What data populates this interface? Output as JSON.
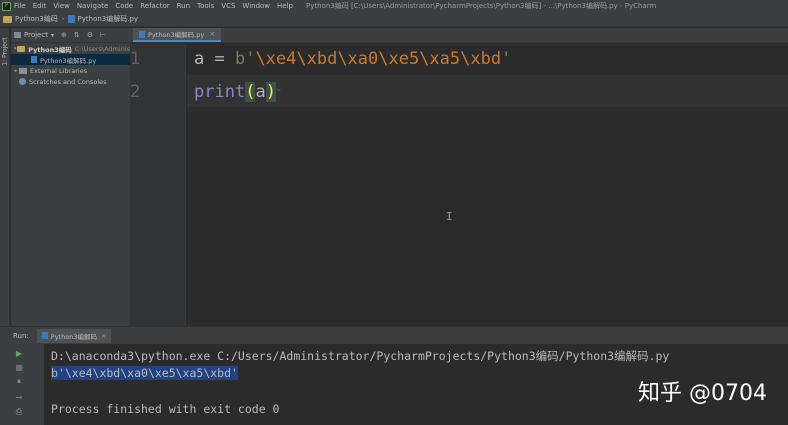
{
  "menubar": {
    "items": [
      "File",
      "Edit",
      "View",
      "Navigate",
      "Code",
      "Refactor",
      "Run",
      "Tools",
      "VCS",
      "Window",
      "Help"
    ],
    "window_title": "Python3编码 [C:\\Users\\Administrator\\PycharmProjects\\Python3编码] - ...\\Python3编解码.py - PyCharm"
  },
  "navbar": {
    "project": "Python3编码",
    "file": "Python3编解码.py"
  },
  "left_stripe": {
    "project_tab": "1: Project"
  },
  "project_panel": {
    "title": "Project",
    "tree": {
      "root_name": "Python3编码",
      "root_path": "C:\\Users\\Adminis",
      "file": "Python3编解码.py",
      "external_libraries": "External Libraries",
      "scratches": "Scratches and Consoles"
    }
  },
  "editor": {
    "tab_label": "Python3编解码.py",
    "line_numbers": [
      "1",
      "2"
    ],
    "line1": {
      "var": "a = ",
      "prefix": "b'",
      "escapes": "\\xe4\\xbd\\xa0\\xe5\\xa5\\xbd",
      "suffix": "'"
    },
    "line2": {
      "func": "print",
      "open_paren": "(",
      "arg": "a",
      "close_paren": ")"
    }
  },
  "run": {
    "label": "Run:",
    "tab_label": "Python3编解码",
    "console": {
      "command": "D:\\anaconda3\\python.exe C:/Users/Administrator/PycharmProjects/Python3编码/Python3编解码.py",
      "output": "b'\\xe4\\xbd\\xa0\\xe5\\xa5\\xbd'",
      "exit": "Process finished with exit code 0"
    }
  },
  "watermark": "知乎 @0704",
  "colors": {
    "editor_bg": "#2b2b2b",
    "panel_bg": "#3c3f41",
    "string_green": "#6a8759",
    "escape_orange": "#cc7832",
    "builtin_purple": "#8888c6",
    "selection_blue": "#214283"
  }
}
